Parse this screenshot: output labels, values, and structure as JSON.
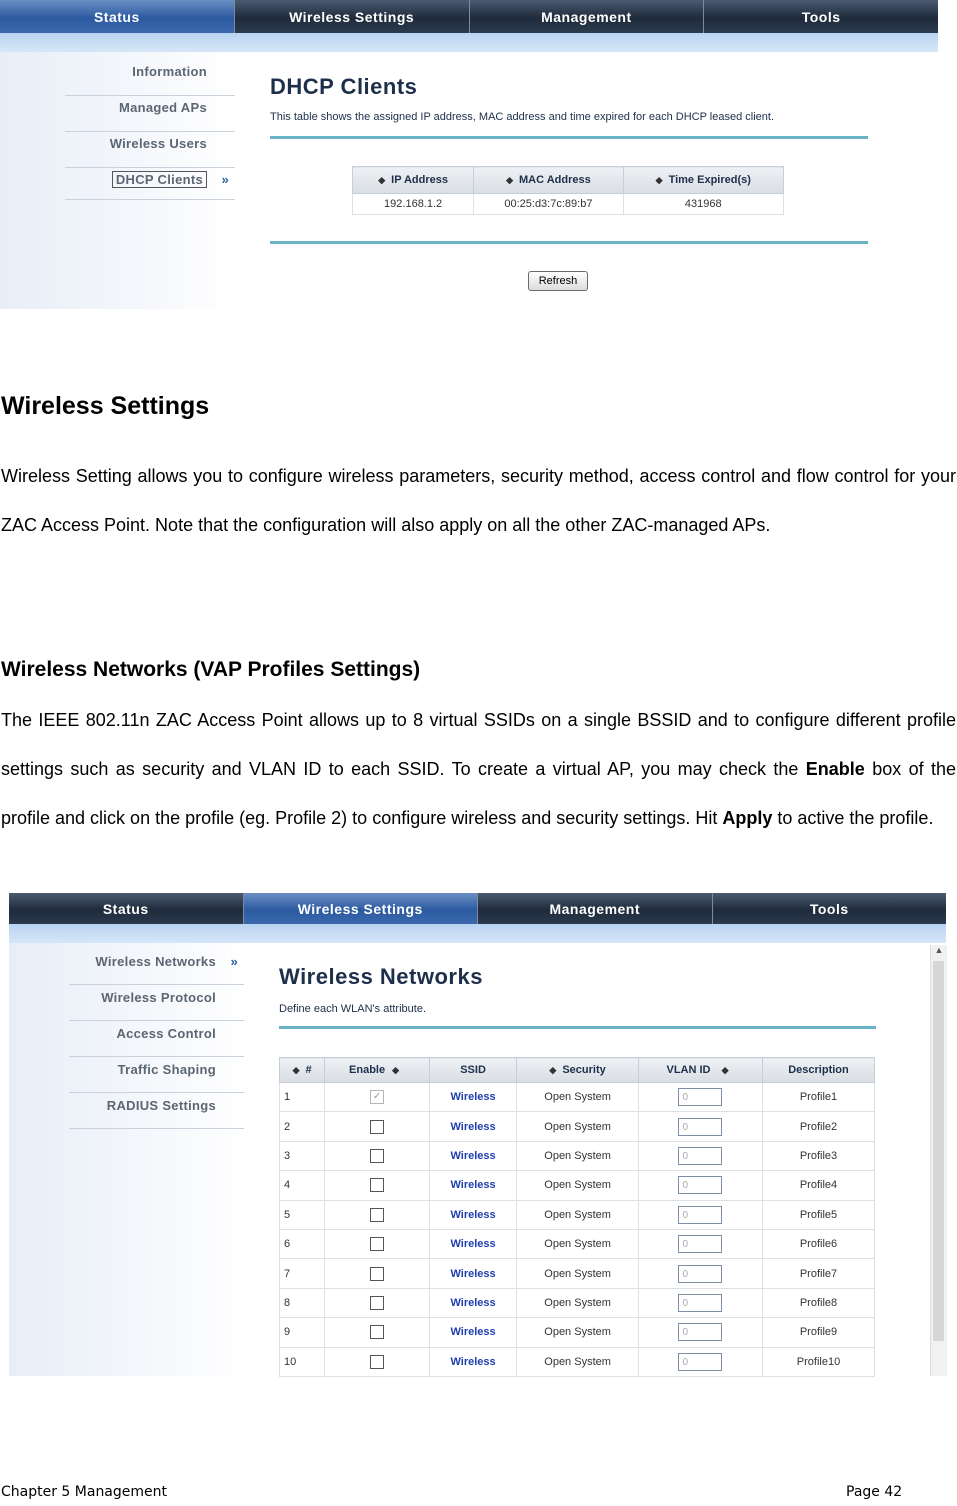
{
  "screenshot1": {
    "tabs": [
      "Status",
      "Wireless Settings",
      "Management",
      "Tools"
    ],
    "sidebar": [
      "Information",
      "Managed APs",
      "Wireless Users",
      "DHCP Clients"
    ],
    "title": "DHCP Clients",
    "description": "This table shows the assigned IP address, MAC address and time expired for each DHCP leased client.",
    "headers": [
      "IP Address",
      "MAC Address",
      "Time Expired(s)"
    ],
    "rows": [
      [
        "192.168.1.2",
        "00:25:d3:7c:89:b7",
        "431968"
      ]
    ],
    "refresh_label": "Refresh"
  },
  "section": {
    "heading": "Wireless Settings",
    "paragraph": "Wireless Setting allows you to configure wireless parameters, security method, access control and flow control for your ZAC Access Point.  Note that the configuration will also apply on all the other ZAC-managed APs."
  },
  "subsection": {
    "heading": "Wireless Networks (VAP Profiles Settings)",
    "paragraph_part1": "The IEEE 802.11n ZAC Access Point allows up to 8 virtual SSIDs on a single BSSID and to configure different profile settings such as security and VLAN ID to each SSID.   To create a virtual AP, you may check the ",
    "enable_word": "Enable",
    "paragraph_part2": " box of the profile and click on the profile (eg. Profile 2) to configure wireless and security settings.    Hit ",
    "apply_word": "Apply",
    "paragraph_part3": " to active the profile."
  },
  "screenshot2": {
    "tabs": [
      "Status",
      "Wireless Settings",
      "Management",
      "Tools"
    ],
    "sidebar": [
      "Wireless Networks",
      "Wireless Protocol",
      "Access Control",
      "Traffic Shaping",
      "RADIUS Settings"
    ],
    "title": "Wireless Networks",
    "description": "Define each WLAN's attribute.",
    "headers": [
      "#",
      "Enable",
      "SSID",
      "Security",
      "VLAN ID",
      "Description"
    ],
    "rows": [
      {
        "num": "1",
        "enabled": true,
        "ssid": "Wireless",
        "security": "Open System",
        "vlan": "0",
        "desc": "Profile1"
      },
      {
        "num": "2",
        "enabled": false,
        "ssid": "Wireless",
        "security": "Open System",
        "vlan": "0",
        "desc": "Profile2"
      },
      {
        "num": "3",
        "enabled": false,
        "ssid": "Wireless",
        "security": "Open System",
        "vlan": "0",
        "desc": "Profile3"
      },
      {
        "num": "4",
        "enabled": false,
        "ssid": "Wireless",
        "security": "Open System",
        "vlan": "0",
        "desc": "Profile4"
      },
      {
        "num": "5",
        "enabled": false,
        "ssid": "Wireless",
        "security": "Open System",
        "vlan": "0",
        "desc": "Profile5"
      },
      {
        "num": "6",
        "enabled": false,
        "ssid": "Wireless",
        "security": "Open System",
        "vlan": "0",
        "desc": "Profile6"
      },
      {
        "num": "7",
        "enabled": false,
        "ssid": "Wireless",
        "security": "Open System",
        "vlan": "0",
        "desc": "Profile7"
      },
      {
        "num": "8",
        "enabled": false,
        "ssid": "Wireless",
        "security": "Open System",
        "vlan": "0",
        "desc": "Profile8"
      },
      {
        "num": "9",
        "enabled": false,
        "ssid": "Wireless",
        "security": "Open System",
        "vlan": "0",
        "desc": "Profile9"
      },
      {
        "num": "10",
        "enabled": false,
        "ssid": "Wireless",
        "security": "Open System",
        "vlan": "0",
        "desc": "Profile10"
      }
    ]
  },
  "footer": {
    "chapter": "Chapter 5 Management",
    "page": "Page 42"
  }
}
